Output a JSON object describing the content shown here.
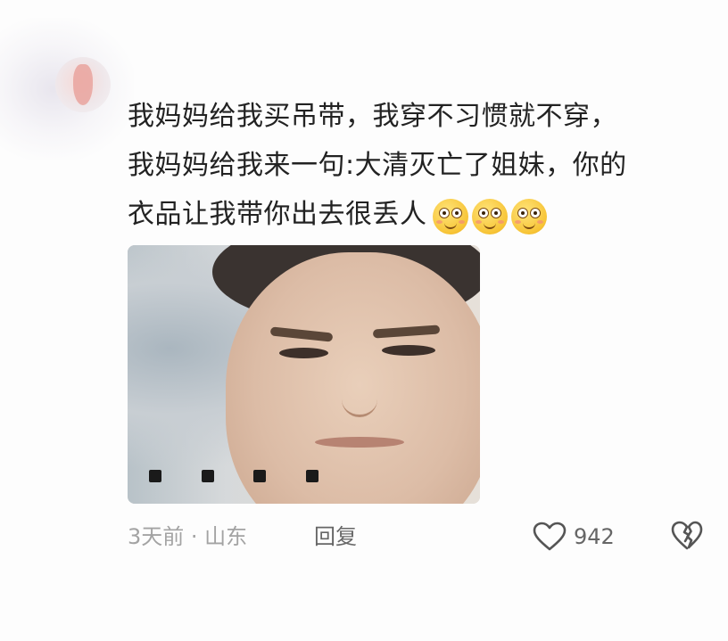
{
  "comment": {
    "lines": [
      "我妈妈给我买吊带，我穿不习惯就不穿，",
      "我妈妈给我来一句:大清灭亡了姐妹，你的",
      "衣品让我带你出去很丢人"
    ],
    "emojis": [
      "smiling-face-emoji",
      "smiling-face-emoji",
      "smiling-face-emoji"
    ]
  },
  "meta": {
    "time_location": "3天前 · 山东",
    "reply_label": "回复",
    "like_count": "942"
  },
  "icons": {
    "like": "heart-outline-icon",
    "dislike": "broken-heart-icon"
  },
  "colors": {
    "text": "#222222",
    "meta": "#a3a3a3",
    "action": "#666666"
  }
}
